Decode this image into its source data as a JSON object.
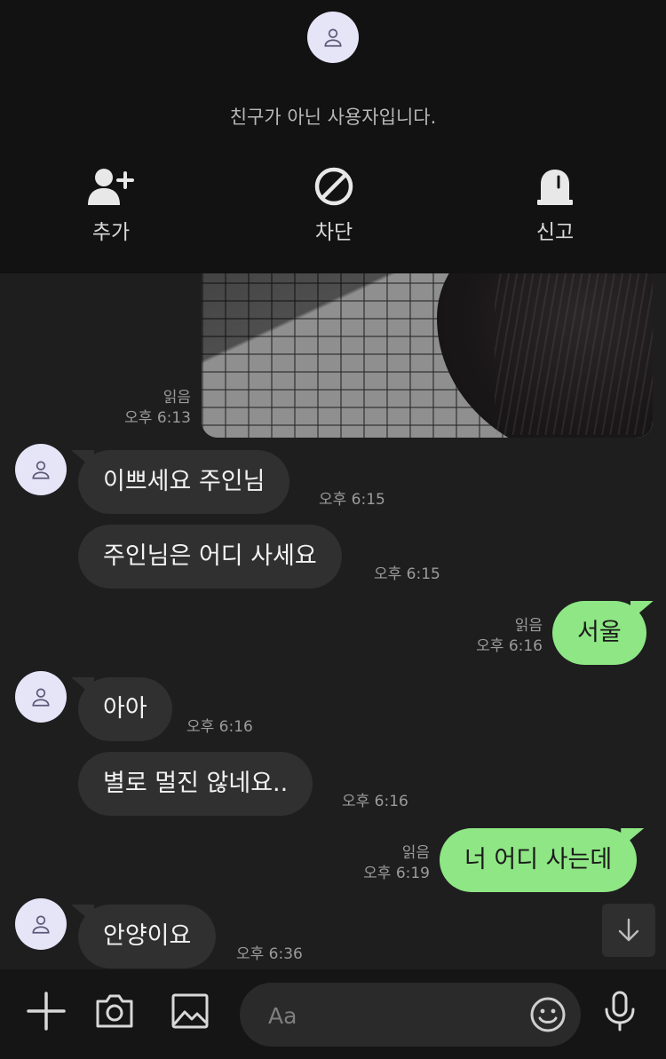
{
  "banner": {
    "not_friend_text": "친구가 아닌 사용자입니다.",
    "actions": [
      {
        "label": "추가",
        "icon": "add-friend-icon"
      },
      {
        "label": "차단",
        "icon": "block-icon"
      },
      {
        "label": "신고",
        "icon": "report-icon"
      }
    ]
  },
  "messages": [
    {
      "direction": "out",
      "type": "image",
      "read": "읽음",
      "time": "오후 6:13"
    },
    {
      "direction": "in",
      "text": "이쁘세요 주인님",
      "time": "오후 6:15"
    },
    {
      "direction": "in",
      "text": "주인님은 어디 사세요",
      "time": "오후 6:15"
    },
    {
      "direction": "out",
      "text": "서울",
      "read": "읽음",
      "time": "오후 6:16"
    },
    {
      "direction": "in",
      "text": "아아",
      "time": "오후 6:16"
    },
    {
      "direction": "in",
      "text": "별로 멀진 않네요..",
      "time": "오후 6:16"
    },
    {
      "direction": "out",
      "text": "너 어디 사는데",
      "read": "읽음",
      "time": "오후 6:19"
    },
    {
      "direction": "in",
      "text": "안양이요",
      "time": "오후 6:36"
    }
  ],
  "input": {
    "placeholder": "Aa",
    "value": ""
  },
  "icons": {
    "plus": "plus-icon",
    "camera": "camera-icon",
    "gallery": "image-icon",
    "emoji": "emoji-icon",
    "mic": "microphone-icon",
    "scroll": "arrow-down-icon"
  },
  "colors": {
    "outgoing_bubble": "#8ee684",
    "incoming_bubble": "#303031",
    "avatar_bg": "#e6e4f7",
    "background": "#1e1e1f"
  }
}
